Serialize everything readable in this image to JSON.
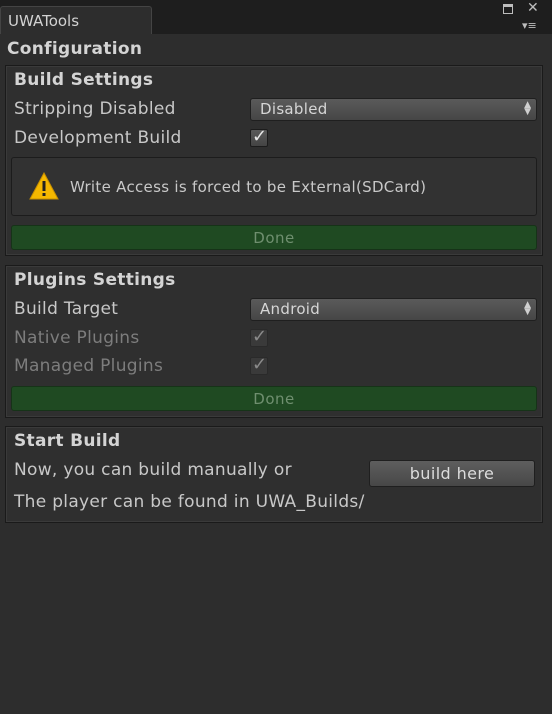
{
  "window": {
    "tab_title": "UWATools",
    "heading": "Configuration"
  },
  "build_settings": {
    "title": "Build Settings",
    "stripping_label": "Stripping Disabled",
    "stripping_value": "Disabled",
    "dev_build_label": "Development Build",
    "dev_build_checked": true,
    "warning_text": "Write Access is forced to be External(SDCard)",
    "done_label": "Done"
  },
  "plugins_settings": {
    "title": "Plugins Settings",
    "build_target_label": "Build Target",
    "build_target_value": "Android",
    "native_plugins_label": "Native Plugins",
    "native_plugins_checked": true,
    "managed_plugins_label": "Managed Plugins",
    "managed_plugins_checked": true,
    "done_label": "Done"
  },
  "start_build": {
    "title": "Start Build",
    "manual_text": "Now, you can build manually or",
    "build_button_label": "build here",
    "output_text": "The player can be found in UWA_Builds/"
  },
  "icons": {
    "warning": "warning-triangle-icon",
    "check": "checkmark-icon",
    "dropdown": "up-down-arrows-icon",
    "maximize": "maximize-icon",
    "close": "close-icon",
    "menu": "tab-menu-icon"
  },
  "colors": {
    "window_bg": "#2d2d2d",
    "done_button_bg": "#1f4a22",
    "warning_yellow": "#f5b800"
  }
}
